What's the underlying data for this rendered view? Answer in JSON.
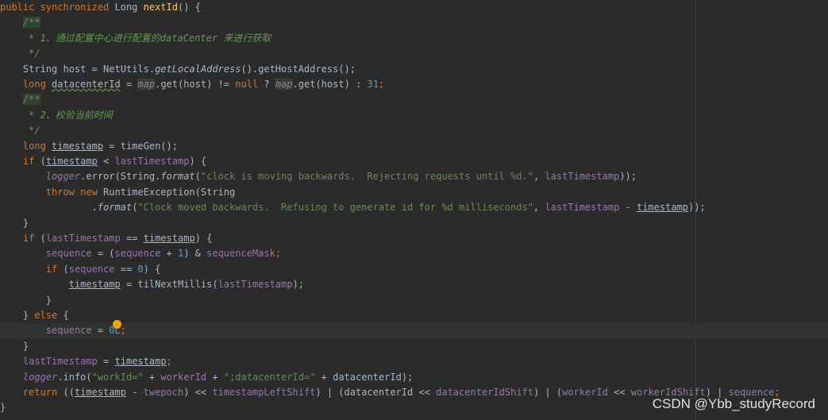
{
  "editor": {
    "lines": [
      {
        "indent": "",
        "tokens": [
          {
            "t": "public ",
            "c": "kw"
          },
          {
            "t": "synchronized ",
            "c": "kw"
          },
          {
            "t": "Long "
          },
          {
            "t": "nextId",
            "c": "fn"
          },
          {
            "t": "() {"
          }
        ]
      },
      {
        "indent": "    ",
        "tokens": [
          {
            "t": "/**",
            "c": "docmark"
          }
        ]
      },
      {
        "indent": "    ",
        "tokens": [
          {
            "t": " * 1、通过配置中心进行配置的dataCenter 来进行获取",
            "c": "doc"
          }
        ]
      },
      {
        "indent": "    ",
        "tokens": [
          {
            "t": " */",
            "c": "doc"
          }
        ]
      },
      {
        "indent": "    ",
        "tokens": [
          {
            "t": "String host = NetUtils."
          },
          {
            "t": "getLocalAddress",
            "c": "italic"
          },
          {
            "t": "().getHostAddress();"
          }
        ]
      },
      {
        "indent": "    ",
        "tokens": [
          {
            "t": "long ",
            "c": "kw"
          },
          {
            "t": "datacenterId",
            "c": "squig"
          },
          {
            "t": " = "
          },
          {
            "t": "map",
            "c": "sfield warn"
          },
          {
            "t": ".get(host) != "
          },
          {
            "t": "null",
            "c": "kw"
          },
          {
            "t": " ? "
          },
          {
            "t": "map",
            "c": "sfield warn"
          },
          {
            "t": ".get(host) : "
          },
          {
            "t": "31",
            "c": "num"
          },
          {
            "t": ";",
            "c": "kw"
          }
        ]
      },
      {
        "indent": "    ",
        "tokens": [
          {
            "t": "/**",
            "c": "docmark"
          }
        ]
      },
      {
        "indent": "    ",
        "tokens": [
          {
            "t": " * 2、校验当前时间",
            "c": "doc"
          }
        ]
      },
      {
        "indent": "    ",
        "tokens": [
          {
            "t": " */",
            "c": "doc"
          }
        ]
      },
      {
        "indent": "    ",
        "tokens": [
          {
            "t": "long ",
            "c": "kw"
          },
          {
            "t": "timestamp",
            "c": "ul"
          },
          {
            "t": " = timeGen();"
          }
        ]
      },
      {
        "indent": "    ",
        "tokens": [
          {
            "t": "if ",
            "c": "kw"
          },
          {
            "t": "("
          },
          {
            "t": "timestamp",
            "c": "ul"
          },
          {
            "t": " < "
          },
          {
            "t": "lastTimestamp",
            "c": "field"
          },
          {
            "t": ") {"
          }
        ]
      },
      {
        "indent": "        ",
        "tokens": [
          {
            "t": "logger",
            "c": "sfield"
          },
          {
            "t": ".error(String."
          },
          {
            "t": "format",
            "c": "italic"
          },
          {
            "t": "("
          },
          {
            "t": "\"clock is moving backwards.  Rejecting requests until %d.\"",
            "c": "str"
          },
          {
            "t": ", "
          },
          {
            "t": "lastTimestamp",
            "c": "field"
          },
          {
            "t": "));"
          }
        ]
      },
      {
        "indent": "        ",
        "tokens": [
          {
            "t": "throw new ",
            "c": "kw"
          },
          {
            "t": "RuntimeException(String"
          }
        ]
      },
      {
        "indent": "                ",
        "tokens": [
          {
            "t": "."
          },
          {
            "t": "format",
            "c": "italic"
          },
          {
            "t": "("
          },
          {
            "t": "\"Clock moved backwards.  Refusing to generate id for %d milliseconds\"",
            "c": "str"
          },
          {
            "t": ", "
          },
          {
            "t": "lastTimestamp",
            "c": "field"
          },
          {
            "t": " - "
          },
          {
            "t": "timestamp",
            "c": "ul"
          },
          {
            "t": "));"
          }
        ]
      },
      {
        "indent": "    ",
        "tokens": [
          {
            "t": "}"
          }
        ]
      },
      {
        "indent": "    ",
        "tokens": [
          {
            "t": "if ",
            "c": "kw"
          },
          {
            "t": "("
          },
          {
            "t": "lastTimestamp",
            "c": "field"
          },
          {
            "t": " == "
          },
          {
            "t": "timestamp",
            "c": "ul"
          },
          {
            "t": ") {"
          }
        ]
      },
      {
        "indent": "        ",
        "tokens": [
          {
            "t": "sequence",
            "c": "field"
          },
          {
            "t": " = ("
          },
          {
            "t": "sequence",
            "c": "field"
          },
          {
            "t": " + "
          },
          {
            "t": "1",
            "c": "num"
          },
          {
            "t": ") & "
          },
          {
            "t": "sequenceMask",
            "c": "field"
          },
          {
            "t": ";",
            "c": "kw"
          }
        ]
      },
      {
        "indent": "        ",
        "tokens": [
          {
            "t": "if ",
            "c": "kw"
          },
          {
            "t": "("
          },
          {
            "t": "sequence",
            "c": "field"
          },
          {
            "t": " == "
          },
          {
            "t": "0",
            "c": "num"
          },
          {
            "t": ") {"
          }
        ]
      },
      {
        "indent": "            ",
        "tokens": [
          {
            "t": "timestamp",
            "c": "ul"
          },
          {
            "t": " = tilNextMillis("
          },
          {
            "t": "lastTimestamp",
            "c": "field"
          },
          {
            "t": ");"
          }
        ]
      },
      {
        "indent": "        ",
        "tokens": [
          {
            "t": "}"
          }
        ]
      },
      {
        "indent": "    ",
        "tokens": [
          {
            "t": "} "
          },
          {
            "t": "else ",
            "c": "kw"
          },
          {
            "t": "{"
          }
        ]
      },
      {
        "indent": "        ",
        "current": true,
        "tokens": [
          {
            "t": "sequence",
            "c": "field"
          },
          {
            "t": " = "
          },
          {
            "t": "0L",
            "c": "num"
          },
          {
            "t": ";",
            "c": "kw"
          }
        ]
      },
      {
        "indent": "    ",
        "tokens": [
          {
            "t": "}"
          }
        ]
      },
      {
        "indent": "    ",
        "tokens": [
          {
            "t": "lastTimestamp",
            "c": "field"
          },
          {
            "t": " = "
          },
          {
            "t": "timestamp",
            "c": "ul"
          },
          {
            "t": ";",
            "c": "kw"
          }
        ]
      },
      {
        "indent": "    ",
        "tokens": [
          {
            "t": "logger",
            "c": "sfield"
          },
          {
            "t": ".info("
          },
          {
            "t": "\"workId=\"",
            "c": "str"
          },
          {
            "t": " + "
          },
          {
            "t": "workerId",
            "c": "field"
          },
          {
            "t": " + "
          },
          {
            "t": "\";datacenterId=\"",
            "c": "str"
          },
          {
            "t": " + "
          },
          {
            "t": "datacenterId"
          },
          {
            "t": ");"
          }
        ]
      },
      {
        "indent": "    ",
        "tokens": [
          {
            "t": "return ",
            "c": "kw"
          },
          {
            "t": "(("
          },
          {
            "t": "timestamp",
            "c": "ul"
          },
          {
            "t": " - "
          },
          {
            "t": "twepoch",
            "c": "field"
          },
          {
            "t": ") << "
          },
          {
            "t": "timestampLeftShift",
            "c": "field"
          },
          {
            "t": ") | (datacenterId << "
          },
          {
            "t": "datacenterIdShift",
            "c": "field"
          },
          {
            "t": ") | ("
          },
          {
            "t": "workerId",
            "c": "field"
          },
          {
            "t": " << "
          },
          {
            "t": "workerIdShift",
            "c": "field"
          },
          {
            "t": ") | "
          },
          {
            "t": "sequence",
            "c": "field"
          },
          {
            "t": ";",
            "c": "kw"
          }
        ]
      },
      {
        "indent": "",
        "tokens": [
          {
            "t": "}"
          }
        ]
      }
    ]
  },
  "intention_icon": "lightbulb-icon",
  "watermark": "CSDN @Ybb_studyRecord",
  "colors": {
    "background": "#2b2b2b",
    "current_line": "#323232",
    "keyword": "#cc7832",
    "method_decl": "#ffc66d",
    "string": "#6a8759",
    "number": "#6897bb",
    "field": "#9876aa",
    "javadoc": "#629755",
    "default_text": "#a9b7c6",
    "bulb": "#f0a30a"
  }
}
